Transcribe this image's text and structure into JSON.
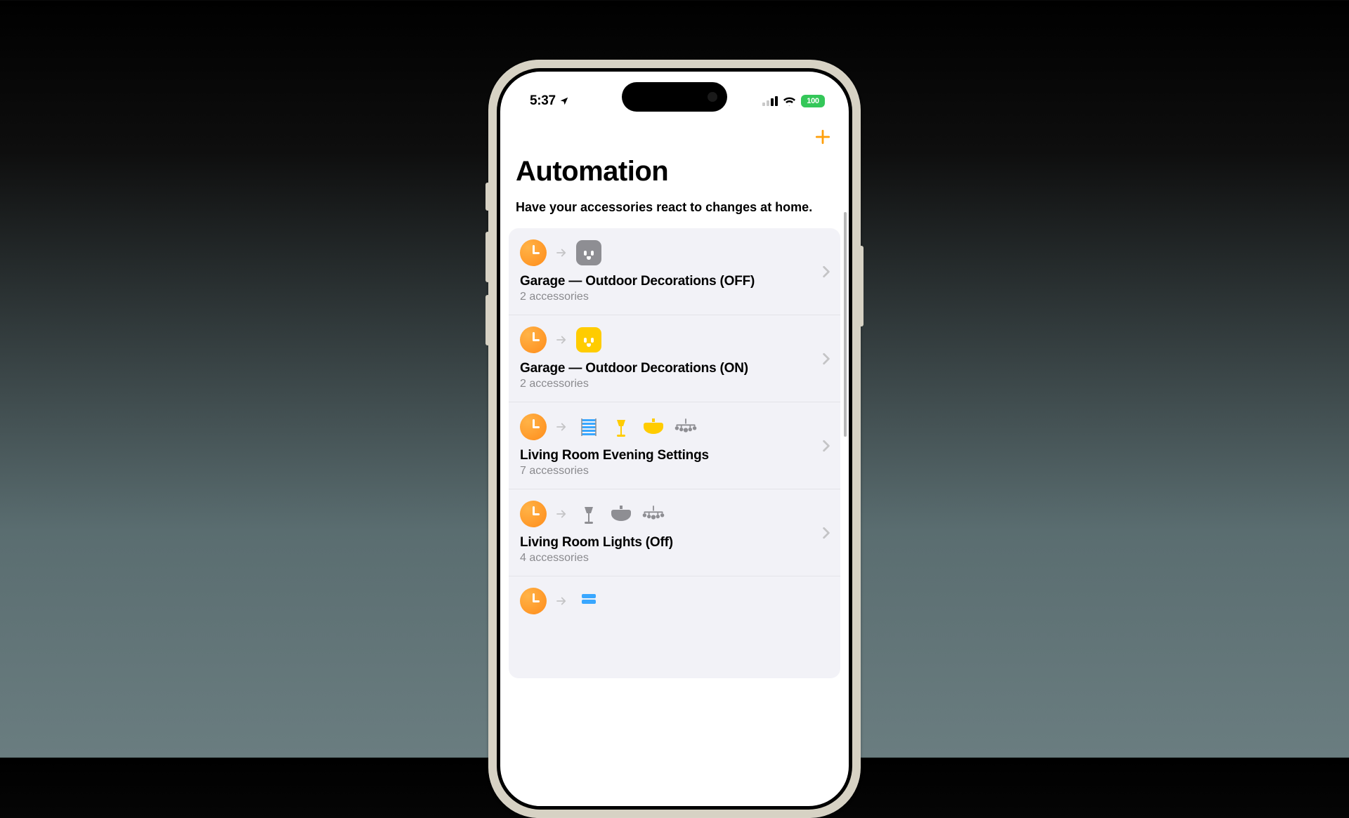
{
  "statusBar": {
    "time": "5:37",
    "battery": "100"
  },
  "page": {
    "title": "Automation",
    "subtitle": "Have your accessories react to changes at home."
  },
  "automations": [
    {
      "title": "Garage — Outdoor Decorations (OFF)",
      "subtitle": "2 accessories",
      "icons": [
        "outlet-off"
      ]
    },
    {
      "title": "Garage — Outdoor Decorations (ON)",
      "subtitle": "2 accessories",
      "icons": [
        "outlet-on"
      ]
    },
    {
      "title": "Living Room Evening Settings",
      "subtitle": "7 accessories",
      "icons": [
        "blinds",
        "floor-lamp-on",
        "ceiling-on",
        "chandelier-off"
      ]
    },
    {
      "title": "Living Room Lights (Off)",
      "subtitle": "4 accessories",
      "icons": [
        "floor-lamp-off",
        "ceiling-off",
        "chandelier-off"
      ]
    }
  ],
  "colors": {
    "accent": "#ff9500",
    "battery": "#34c759",
    "onYellow": "#ffcc00"
  }
}
